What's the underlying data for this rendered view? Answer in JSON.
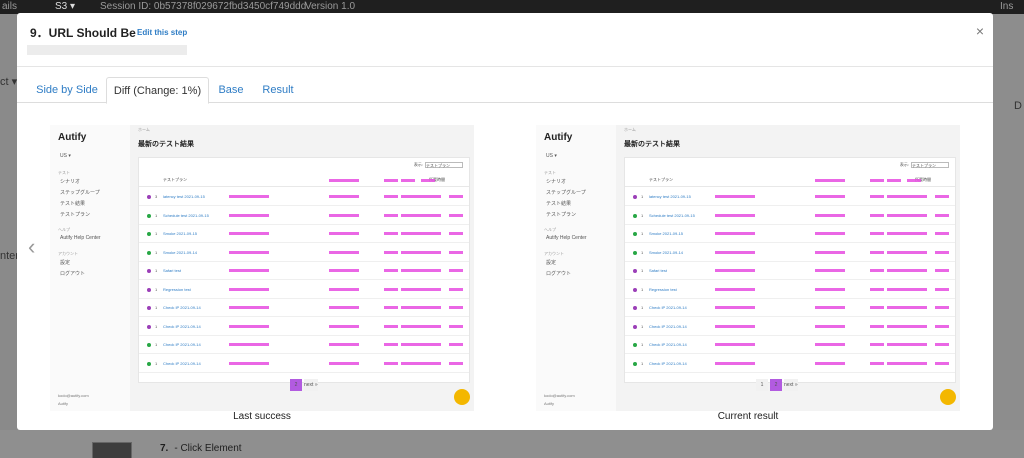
{
  "background": {
    "topbar_fragments": [
      "ails",
      "S3 ▾",
      "Session ID: 0b57378f029672fbd3450cf749ddd",
      "Version 1.0",
      "Ins"
    ],
    "side_text_1": "ct ▾",
    "side_text_2": "nter",
    "right_text": "D",
    "next_step_number": "7.",
    "next_step_label": "- Click Element"
  },
  "modal": {
    "title": "9．URL Should Be",
    "edit_link": "Edit this step",
    "close_glyph": "×"
  },
  "tabs": [
    {
      "label": "Side by Side",
      "active": false
    },
    {
      "label": "Diff (Change: 1%)",
      "active": true
    },
    {
      "label": "Base",
      "active": false
    },
    {
      "label": "Result",
      "active": false
    }
  ],
  "nav": {
    "prev_glyph": "‹"
  },
  "screenshots": [
    {
      "caption": "Last success",
      "app": {
        "logo": "Autify",
        "workspace": "US ▾",
        "sections": [
          {
            "heading": "テスト",
            "items": [
              "シナリオ",
              "ステップグループ",
              "テスト結果",
              "テストプラン"
            ]
          },
          {
            "heading": "ヘルプ",
            "items": [
              "Autify Help Center"
            ]
          },
          {
            "heading": "アカウント",
            "items": [
              "設定",
              "ログアウト"
            ]
          }
        ],
        "footer_email": "kodo@autify.com",
        "footer_org": "Autify",
        "breadcrumb": "ホーム",
        "title": "最新のテスト結果",
        "filter_label": "表示:",
        "filter_value": "テストプラン",
        "columns": [
          "テストプラン",
          "",
          "",
          "",
          "所要時間"
        ],
        "rows": [
          {
            "num": "3",
            "name": "latency test 2021-09-15",
            "status": "purple"
          },
          {
            "num": "1",
            "name": "Schedule test 2021-09-15",
            "status": "green"
          },
          {
            "num": "1",
            "name": "Smoke 2021-09-15",
            "status": "green"
          },
          {
            "num": "1",
            "name": "Smoke 2021-09-14",
            "status": "green"
          },
          {
            "num": "1",
            "name": "Safari test",
            "status": "purple"
          },
          {
            "num": "1",
            "name": "Regression test",
            "status": "purple"
          },
          {
            "num": "1",
            "name": "Check IP 2021-09-14",
            "status": "purple"
          },
          {
            "num": "1",
            "name": "Check IP 2021-09-14",
            "status": "purple"
          },
          {
            "num": "1",
            "name": "Check IP 2021-09-14",
            "status": "green"
          },
          {
            "num": "1",
            "name": "Check IP 2021-09-14",
            "status": "green"
          }
        ],
        "pager": [
          "2",
          "next »"
        ]
      }
    },
    {
      "caption": "Current result",
      "app": {
        "logo": "Autify",
        "workspace": "US ▾",
        "sections": [
          {
            "heading": "テスト",
            "items": [
              "シナリオ",
              "ステップグループ",
              "テスト結果",
              "テストプラン"
            ]
          },
          {
            "heading": "ヘルプ",
            "items": [
              "Autify Help Center"
            ]
          },
          {
            "heading": "アカウント",
            "items": [
              "設定",
              "ログアウト"
            ]
          }
        ],
        "footer_email": "kodo@autify.com",
        "footer_org": "Autify",
        "breadcrumb": "ホーム",
        "title": "最新のテスト結果",
        "filter_label": "表示:",
        "filter_value": "テストプラン",
        "columns": [
          "テストプラン",
          "",
          "",
          "",
          "所要時間"
        ],
        "rows": [
          {
            "num": "1",
            "name": "latency test 2021-09-15",
            "status": "purple"
          },
          {
            "num": "1",
            "name": "Schedule test 2021-09-15",
            "status": "green"
          },
          {
            "num": "1",
            "name": "Smoke 2021-09-15",
            "status": "green"
          },
          {
            "num": "1",
            "name": "Smoke 2021-09-14",
            "status": "green"
          },
          {
            "num": "1",
            "name": "Safari test",
            "status": "purple"
          },
          {
            "num": "1",
            "name": "Regression test",
            "status": "purple"
          },
          {
            "num": "1",
            "name": "Check IP 2021-09-14",
            "status": "purple"
          },
          {
            "num": "1",
            "name": "Check IP 2021-09-14",
            "status": "purple"
          },
          {
            "num": "1",
            "name": "Check IP 2021-09-14",
            "status": "green"
          },
          {
            "num": "1",
            "name": "Check IP 2021-09-14",
            "status": "green"
          }
        ],
        "pager": [
          "1",
          "2",
          "next »"
        ]
      }
    }
  ],
  "colors": {
    "accent": "#2f7dc5",
    "diff_highlight": "#e64ce0",
    "status_green": "#27a745",
    "status_purple": "#9b3fb8",
    "help_button": "#f3b700"
  }
}
